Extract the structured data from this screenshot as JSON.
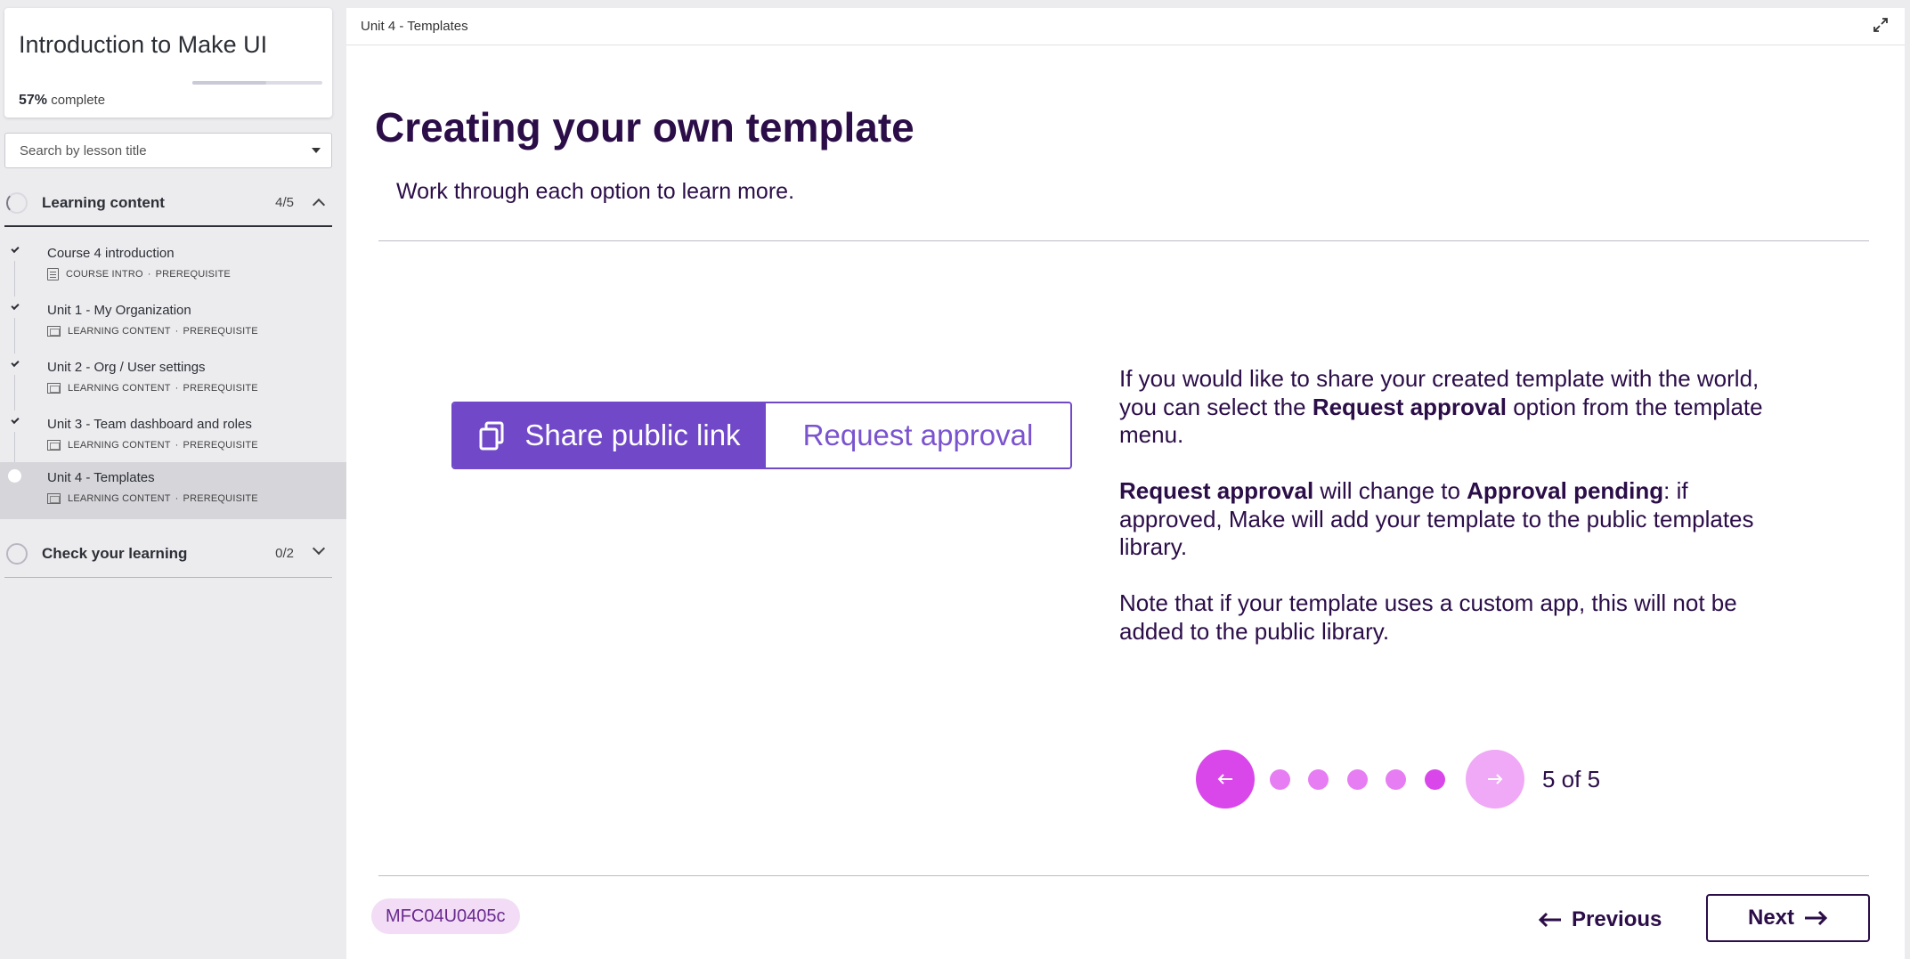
{
  "sidebar": {
    "course_title": "Introduction to Make UI",
    "progress_percent": "57%",
    "progress_suffix": "complete",
    "progress_fraction": 0.57,
    "search_placeholder": "Search by lesson title",
    "sections": [
      {
        "title": "Learning content",
        "count": "4/5",
        "expanded": true
      },
      {
        "title": "Check your learning",
        "count": "0/2",
        "expanded": false
      }
    ],
    "lessons": [
      {
        "name": "Course 4 introduction",
        "icon": "doc-icon",
        "type": "COURSE INTRO",
        "tag": "PREREQUISITE",
        "status": "complete"
      },
      {
        "name": "Unit 1 - My Organization",
        "icon": "screen-icon",
        "type": "LEARNING CONTENT",
        "tag": "PREREQUISITE",
        "status": "complete"
      },
      {
        "name": "Unit 2 - Org / User settings",
        "icon": "screen-icon",
        "type": "LEARNING CONTENT",
        "tag": "PREREQUISITE",
        "status": "complete"
      },
      {
        "name": "Unit 3 - Team dashboard and roles",
        "icon": "screen-icon",
        "type": "LEARNING CONTENT",
        "tag": "PREREQUISITE",
        "status": "complete"
      },
      {
        "name": "Unit 4 - Templates",
        "icon": "screen-icon",
        "type": "LEARNING CONTENT",
        "tag": "PREREQUISITE",
        "status": "current"
      }
    ],
    "meta_separator": "·"
  },
  "main": {
    "unit_title": "Unit 4 - Templates",
    "page_title": "Creating your own template",
    "subtitle": "Work through each option to learn more.",
    "buttons": {
      "share": "Share public link",
      "request": "Request approval"
    },
    "paragraphs": {
      "p1_a": "If you would like to share your created template with the world, you can select the ",
      "p1_b": "Request approval",
      "p1_c": " option from the template menu.",
      "p2_a": "Request approval",
      "p2_b": " will change to ",
      "p2_c": "Approval pending",
      "p2_d": ": if approved, Make will add your template to the public templates library.",
      "p3": "Note that if your template uses a custom app, this will not be added to the public library."
    },
    "carousel": {
      "current": 5,
      "total": 5,
      "count_label": "5 of 5"
    },
    "code": "MFC04U0405c",
    "nav": {
      "previous": "Previous",
      "next": "Next"
    }
  },
  "colors": {
    "brand_dark": "#2b0d48",
    "button_purple": "#7048c8",
    "carousel_pink": "#d947ea",
    "carousel_light": "#f0a9f6"
  }
}
